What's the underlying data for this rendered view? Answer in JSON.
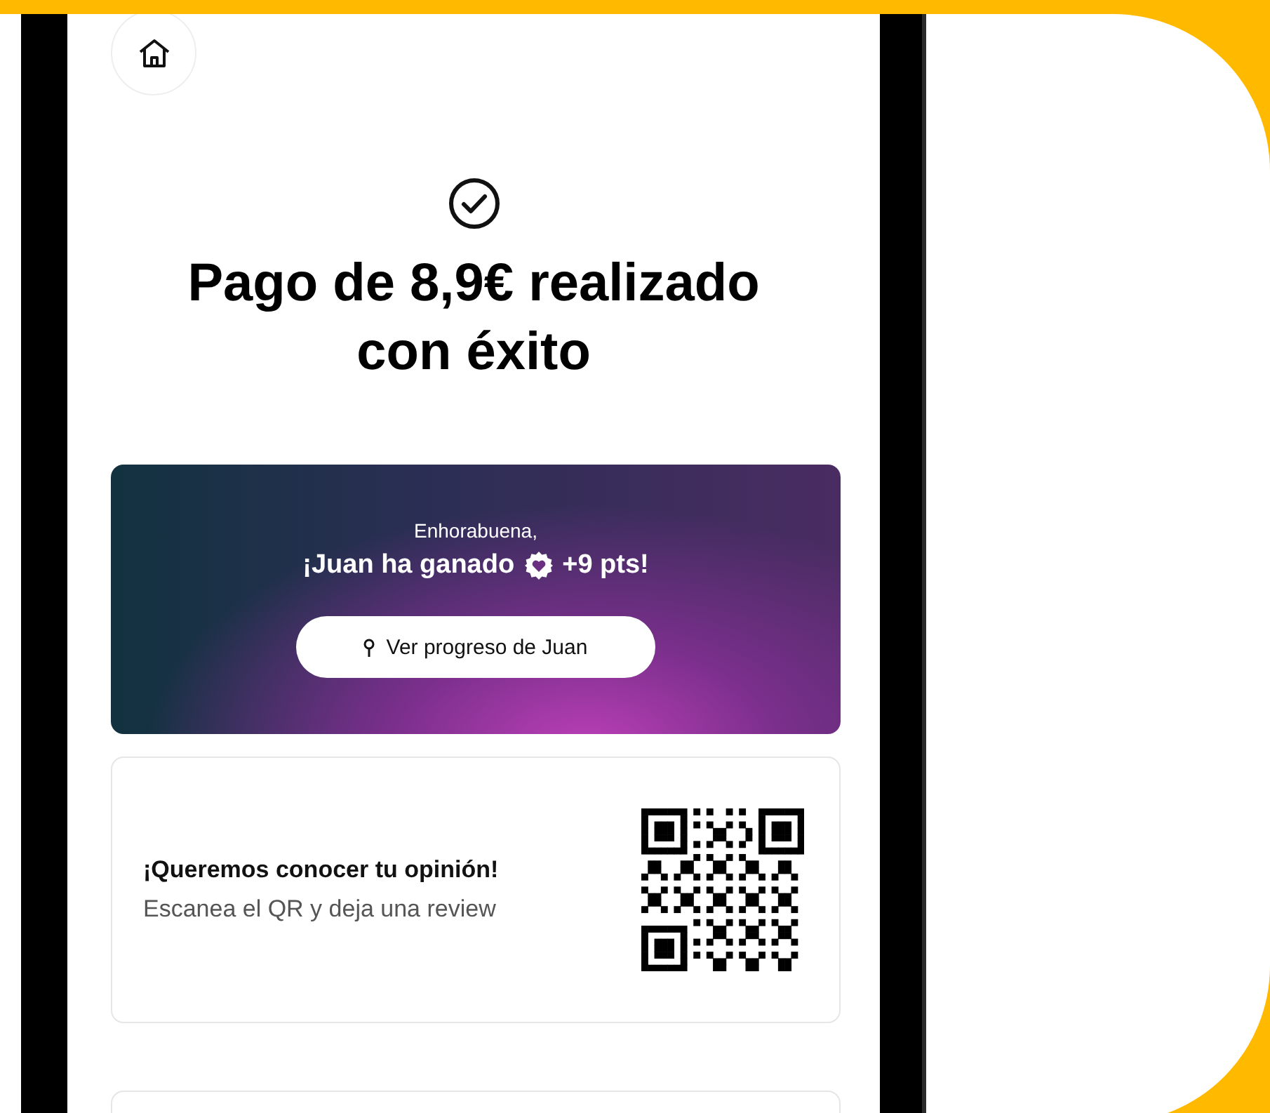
{
  "confirmation": {
    "title": "Pago de 8,9€ realizado con éxito"
  },
  "reward_banner": {
    "greeting": "Enhorabuena,",
    "headline": "¡Juan ha ganado",
    "points": "+9 pts!",
    "button": "Ver progreso de Juan"
  },
  "review_card": {
    "title": "¡Queremos conocer tu opinión!",
    "subtitle": "Escanea el QR y deja una review"
  }
}
